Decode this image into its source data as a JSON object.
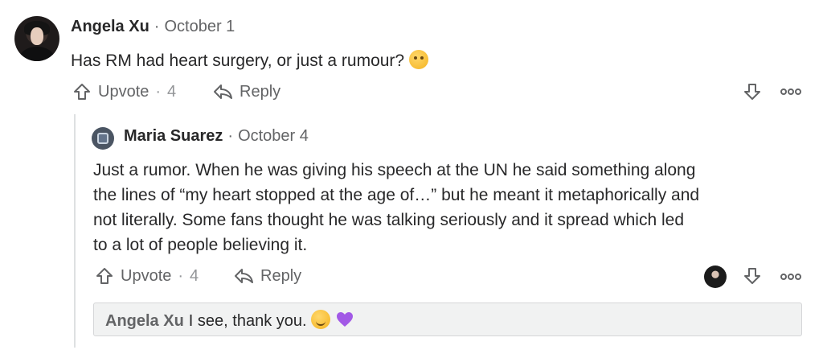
{
  "comment": {
    "author": "Angela Xu",
    "separator": "·",
    "date": "October 1",
    "text": "Has RM had heart surgery, or just a rumour?",
    "emoji": "thinking-face",
    "upvote_label": "Upvote",
    "upvote_sep": "·",
    "upvote_count": "4",
    "reply_label": "Reply"
  },
  "reply": {
    "author": "Maria Suarez",
    "separator": "·",
    "date": "October 4",
    "lines": [
      "Just a rumor. When he was giving his speech at the UN he said something along",
      "the lines of “my heart stopped at the age of…” but he meant it metaphorically and",
      "not literally. Some fans thought he was talking seriously and it spread which led",
      "to a lot of people believing it."
    ],
    "upvote_label": "Upvote",
    "upvote_sep": "·",
    "upvote_count": "4",
    "reply_label": "Reply"
  },
  "nested_reply": {
    "author": "Angela Xu",
    "text": "I see, thank you.",
    "emojis": [
      "smiling-face",
      "purple-heart"
    ]
  },
  "colors": {
    "text": "#282829",
    "muted": "#636466",
    "line": "#dee0e1",
    "box_bg": "#f1f2f2"
  }
}
